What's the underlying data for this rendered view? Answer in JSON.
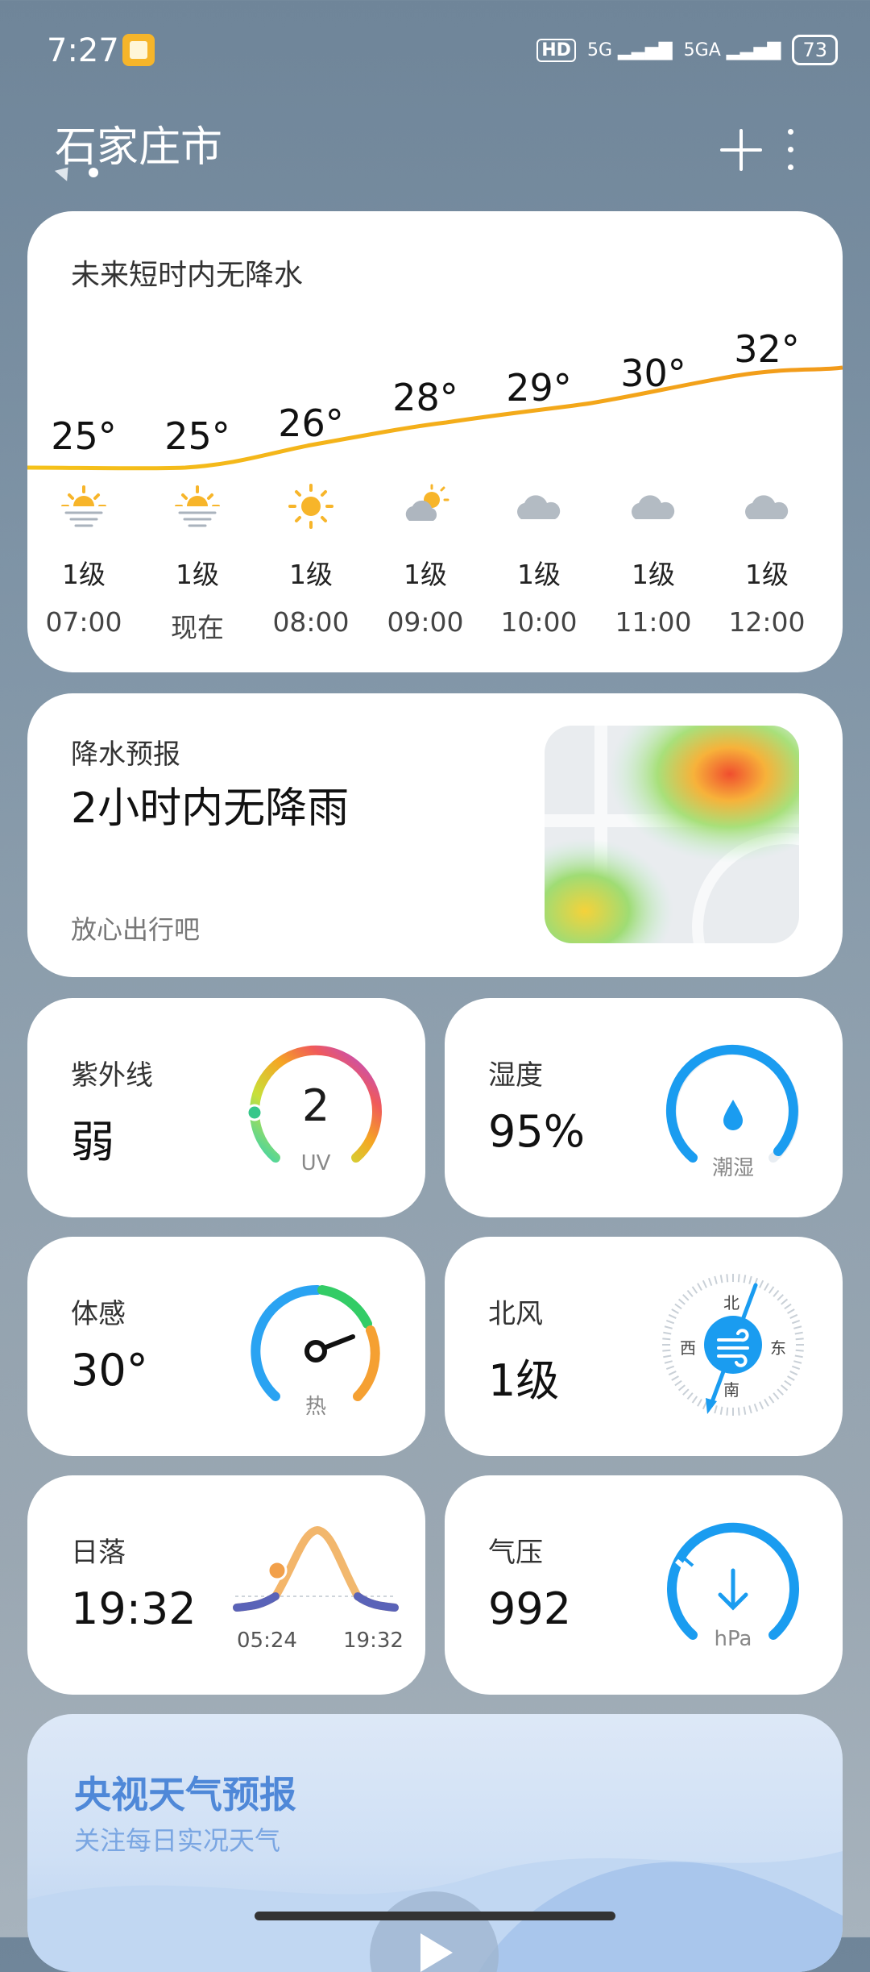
{
  "status_bar": {
    "time": "7:27",
    "network_1": "HD",
    "network_2": "5G",
    "network_3": "5GA",
    "battery": "73"
  },
  "header": {
    "city": "石家庄市"
  },
  "hourly": {
    "title": "未来短时内无降水",
    "items": [
      {
        "temp": "25°",
        "wind": "1级",
        "time": "07:00",
        "icon": "sunrise-icon"
      },
      {
        "temp": "25°",
        "wind": "1级",
        "time": "现在",
        "icon": "sunrise-icon"
      },
      {
        "temp": "26°",
        "wind": "1级",
        "time": "08:00",
        "icon": "sun-icon"
      },
      {
        "temp": "28°",
        "wind": "1级",
        "time": "09:00",
        "icon": "partly-cloudy-icon"
      },
      {
        "temp": "29°",
        "wind": "1级",
        "time": "10:00",
        "icon": "cloud-icon"
      },
      {
        "temp": "30°",
        "wind": "1级",
        "time": "11:00",
        "icon": "cloud-icon"
      },
      {
        "temp": "32°",
        "wind": "1级",
        "time": "12:00",
        "icon": "cloud-icon"
      }
    ]
  },
  "precipitation": {
    "title": "降水预报",
    "main": "2小时内无降雨",
    "sub": "放心出行吧"
  },
  "uv": {
    "title": "紫外线",
    "value": "弱",
    "index": "2",
    "unit": "UV"
  },
  "humidity": {
    "title": "湿度",
    "value": "95%",
    "label": "潮湿"
  },
  "feels_like": {
    "title": "体感",
    "value": "30°",
    "label": "热"
  },
  "wind": {
    "title": "北风",
    "value": "1级",
    "north": "北",
    "south": "南",
    "west": "西",
    "east": "东"
  },
  "sunset": {
    "title": "日落",
    "value": "19:32",
    "sunrise_time": "05:24",
    "sunset_time": "19:32"
  },
  "pressure": {
    "title": "气压",
    "value": "992",
    "unit": "hPa"
  },
  "promo": {
    "title": "央视天气预报",
    "subtitle": "关注每日实况天气"
  },
  "colors": {
    "accent_blue": "#1a9cf0",
    "temp_line": "#f2b316",
    "promo_blue": "#4f88d8"
  }
}
